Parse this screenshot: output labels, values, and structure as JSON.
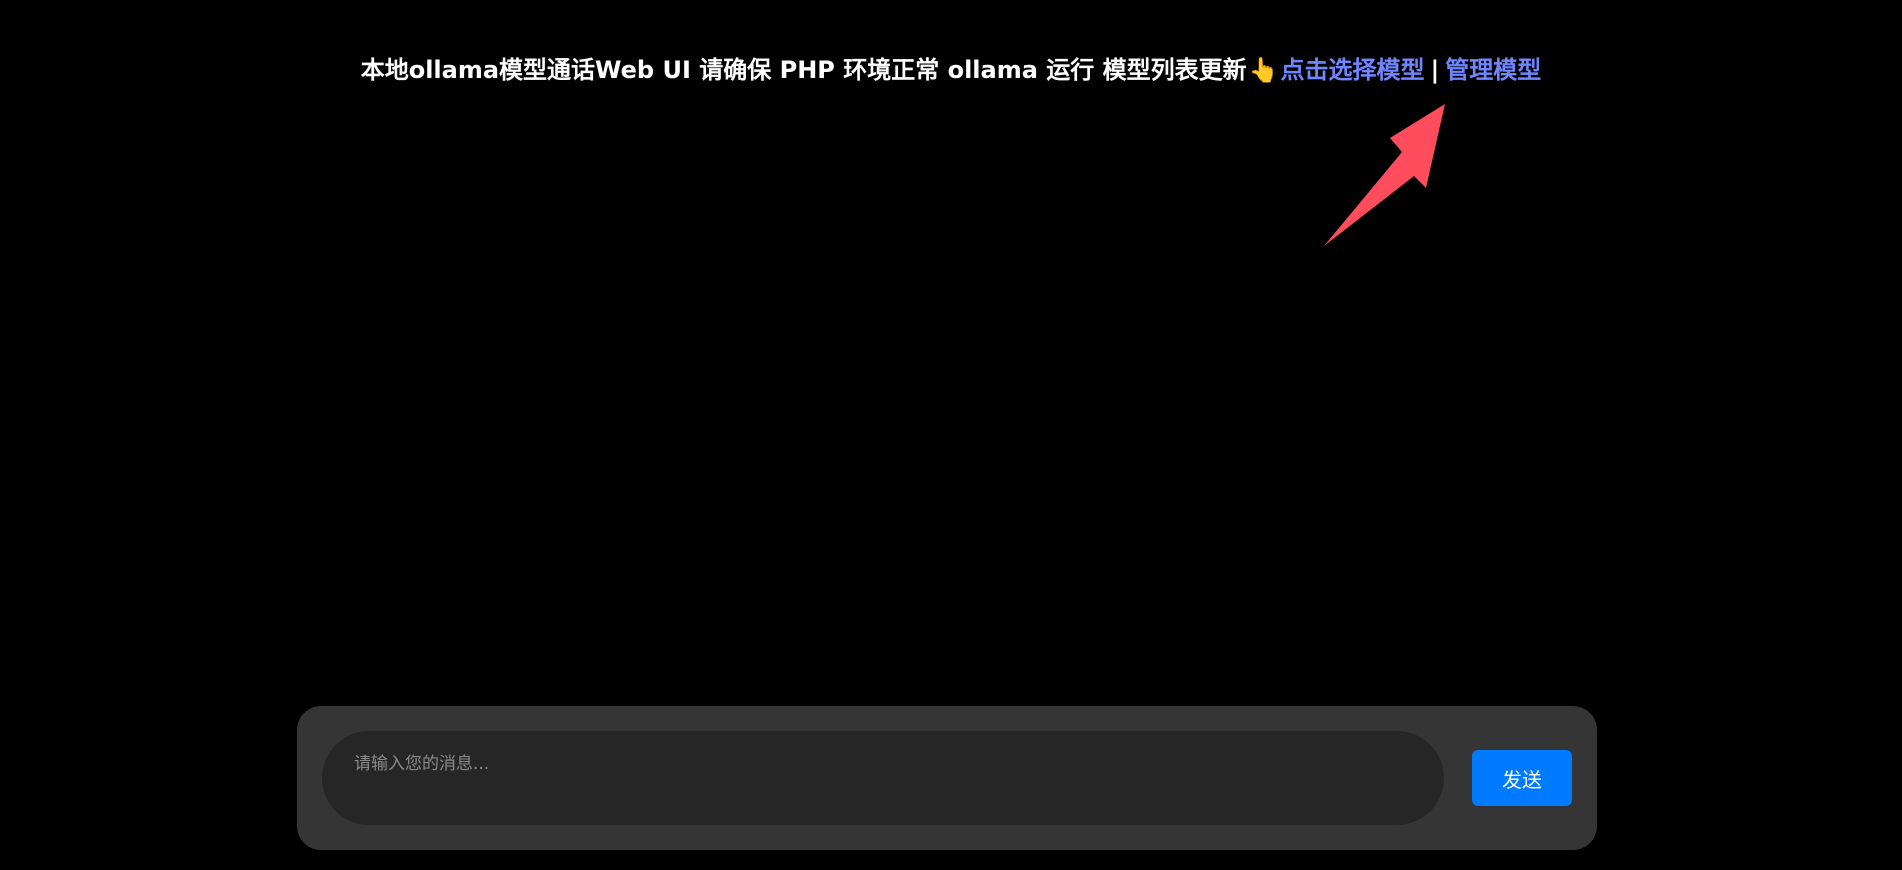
{
  "header": {
    "intro_text": "本地ollama模型通话Web UI 请确保 PHP 环境正常 ollama 运行 模型列表更新",
    "hand_icon": "pointing-up-hand-icon",
    "hand_glyph": "👆",
    "select_model_link": "点击选择模型",
    "separator": "|",
    "manage_model_link": "管理模型"
  },
  "annotation": {
    "arrow_icon": "arrow-annotation-icon",
    "color": "#ff4d5e"
  },
  "composer": {
    "input_placeholder": "请输入您的消息...",
    "input_value": "",
    "send_label": "发送"
  },
  "colors": {
    "background": "#000000",
    "link": "#6f86ff",
    "composer_bg": "#353535",
    "input_bg": "#262626",
    "send_button": "#007bff"
  }
}
